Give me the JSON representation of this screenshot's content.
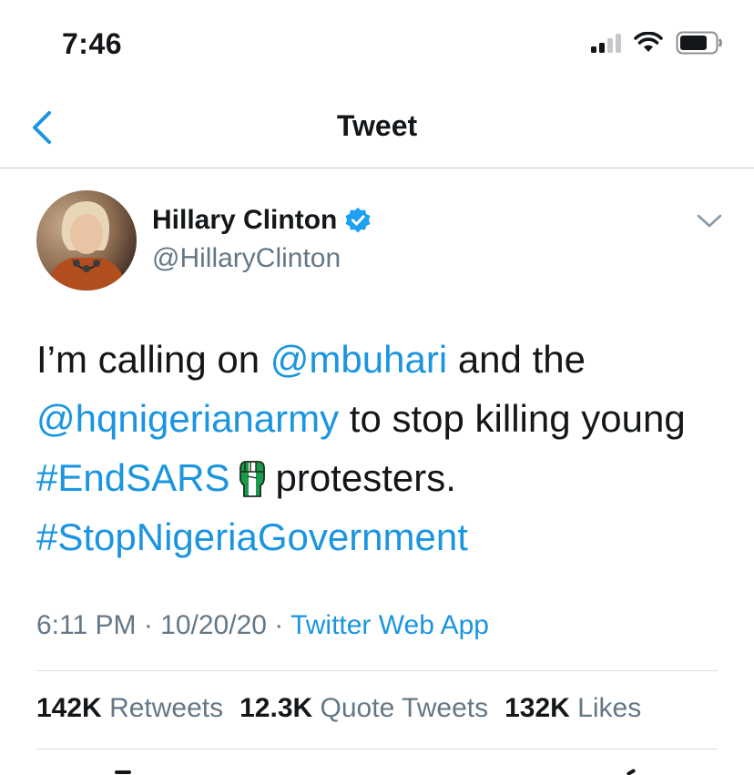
{
  "status_bar": {
    "time": "7:46"
  },
  "header": {
    "title": "Tweet"
  },
  "author": {
    "name": "Hillary Clinton",
    "handle": "@HillaryClinton",
    "verified": true
  },
  "tweet": {
    "segments": [
      {
        "text": "I’m calling on ",
        "type": "text"
      },
      {
        "text": "@mbuhari",
        "type": "mention"
      },
      {
        "text": " and the",
        "type": "text"
      },
      {
        "text": "@hqnigerianarmy",
        "type": "mention"
      },
      {
        "text": " to stop killing young",
        "type": "text"
      },
      {
        "text": "#EndSARS",
        "type": "hashtag"
      },
      {
        "text": "protesters.",
        "type": "text"
      },
      {
        "text": "#StopNigeriaGovernment",
        "type": "hashtag"
      }
    ]
  },
  "meta": {
    "time": "6:11 PM",
    "separator": " · ",
    "date": "10/20/20",
    "source": "Twitter Web App"
  },
  "stats": {
    "retweets_count": "142K",
    "retweets_label": "Retweets",
    "quotes_count": "12.3K",
    "quotes_label": "Quote Tweets",
    "likes_count": "132K",
    "likes_label": "Likes"
  },
  "colors": {
    "link": "#1b95e0",
    "text": "#14171a",
    "secondary": "#657786",
    "verified": "#1da1f2",
    "fist_green": "#1a9b4b"
  },
  "icons": [
    "back-chevron-icon",
    "verified-badge-icon",
    "chevron-down-icon",
    "signal-icon",
    "wifi-icon",
    "battery-icon",
    "raised-fist-flag-emoji"
  ]
}
